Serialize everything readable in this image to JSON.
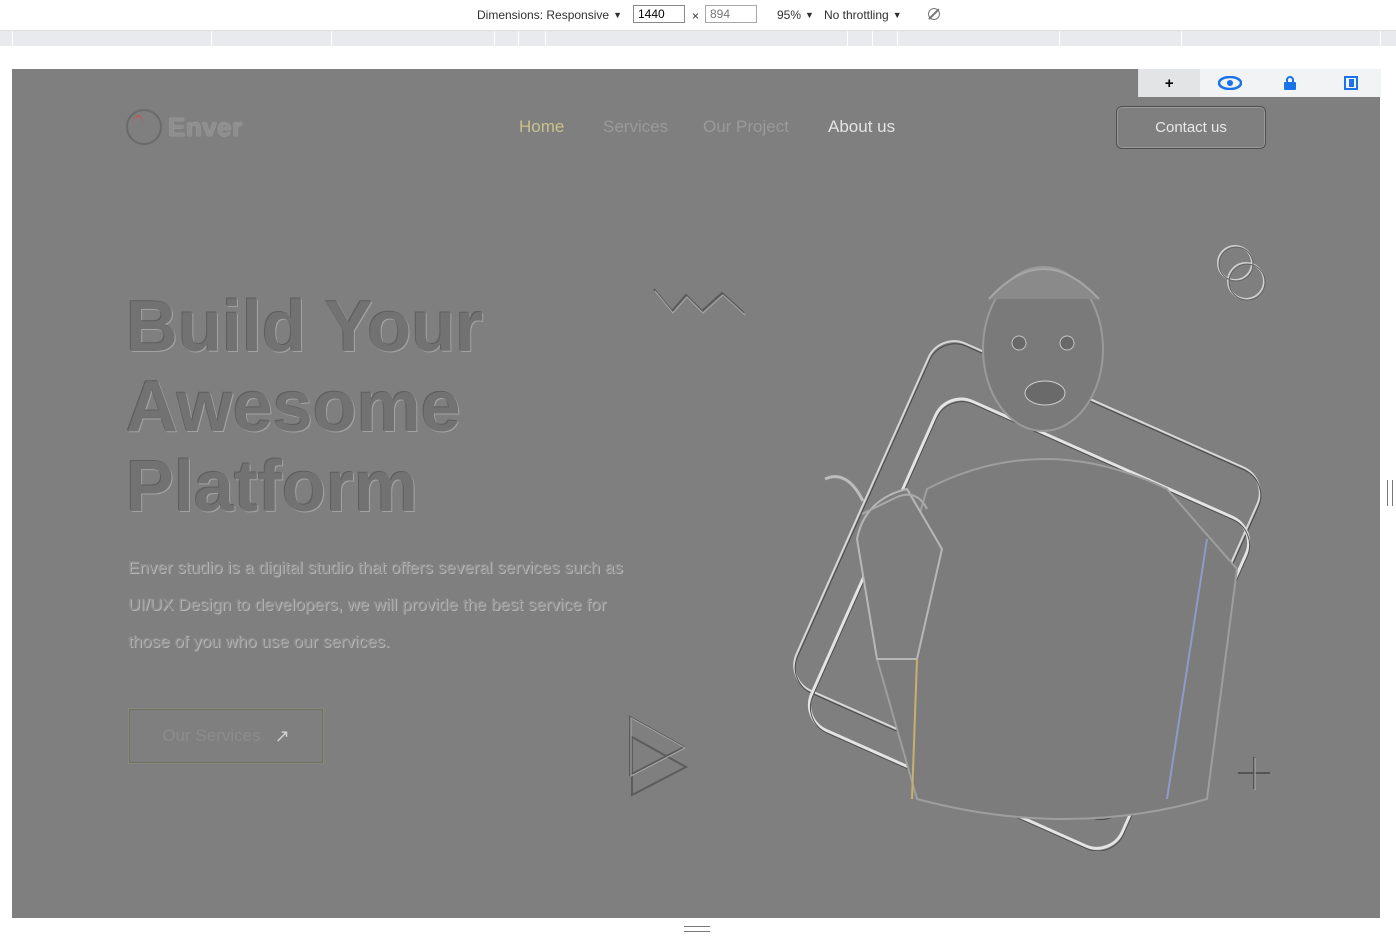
{
  "devtools": {
    "dimensions_label": "Dimensions: Responsive",
    "width_value": "1440",
    "height_placeholder": "894",
    "size_separator": "×",
    "zoom_label": "95%",
    "throttle_label": "No throttling"
  },
  "overlay_tools": {
    "add_label": "+",
    "icons": [
      "eye-icon",
      "lock-icon",
      "layout-icon"
    ]
  },
  "site": {
    "brand": "Enver",
    "nav": [
      {
        "label": "Home",
        "state": "active"
      },
      {
        "label": "Services",
        "state": "normal"
      },
      {
        "label": "Our Project",
        "state": "normal"
      },
      {
        "label": "About us",
        "state": "normal"
      }
    ],
    "contact_label": "Contact us",
    "headline": [
      "Build Your",
      "Awesome",
      "Platform"
    ],
    "description": "Enver studio is a digital studio that offers several services such as UI/UX Design to developers, we will provide the best service for those of you who use our services.",
    "cta_label": "Our Services",
    "cta_arrow": "↗"
  },
  "colors": {
    "page_background": "#7f7f7f",
    "nav_active": "#c9c28a",
    "devtools_accent": "#1a73e8"
  }
}
